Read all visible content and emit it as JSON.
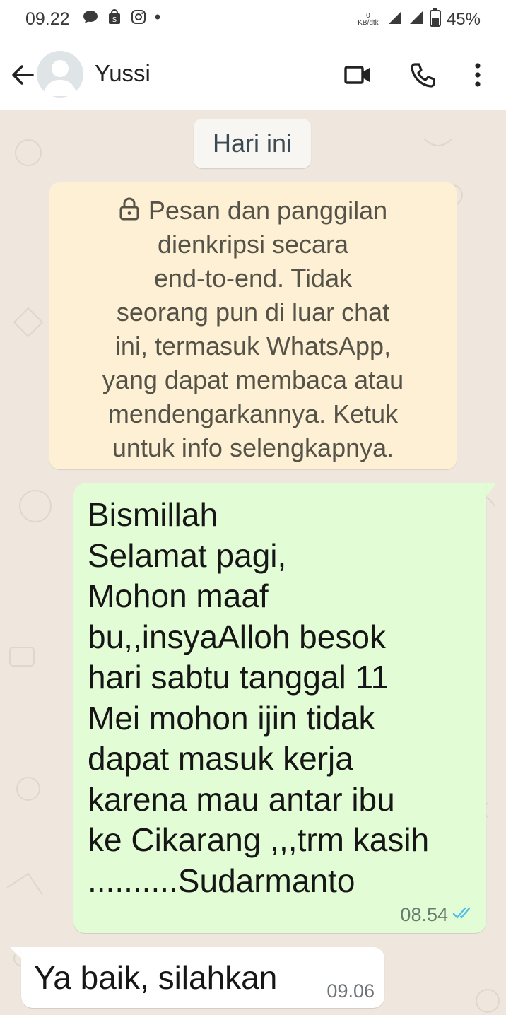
{
  "status_bar": {
    "time": "09.22",
    "data_rate_value": "0",
    "data_rate_unit": "KB/dtk",
    "battery_percent": "45%"
  },
  "header": {
    "contact_name": "Yussi",
    "icons": [
      "back-arrow-icon",
      "video-call-icon",
      "voice-call-icon",
      "more-options-icon"
    ]
  },
  "chat": {
    "date_label": "Hari ini",
    "encryption_notice": [
      "Pesan dan panggilan",
      "dienkripsi secara",
      "end-to-end. Tidak",
      "seorang pun di luar chat",
      "ini, termasuk WhatsApp,",
      "yang dapat membaca atau",
      "mendengarkannya. Ketuk",
      "untuk info selengkapnya."
    ],
    "messages": [
      {
        "direction": "outgoing",
        "lines": [
          "Bismillah",
          "Selamat pagi,",
          "Mohon maaf",
          "bu,,insyaAlloh besok",
          "hari sabtu tanggal 11",
          "Mei mohon ijin tidak",
          "dapat masuk kerja",
          "karena mau antar ibu",
          "ke Cikarang ,,,trm kasih",
          "..........Sudarmanto"
        ],
        "time": "08.54",
        "status": "read"
      },
      {
        "direction": "incoming",
        "text": "Ya baik, silahkan",
        "time": "09.06"
      }
    ]
  },
  "colors": {
    "chat_background": "#efe7de",
    "outgoing_bubble": "#e2fdd6",
    "incoming_bubble": "#ffffff",
    "notice_background": "#fdf0d4",
    "read_ticks": "#53bdeb"
  }
}
